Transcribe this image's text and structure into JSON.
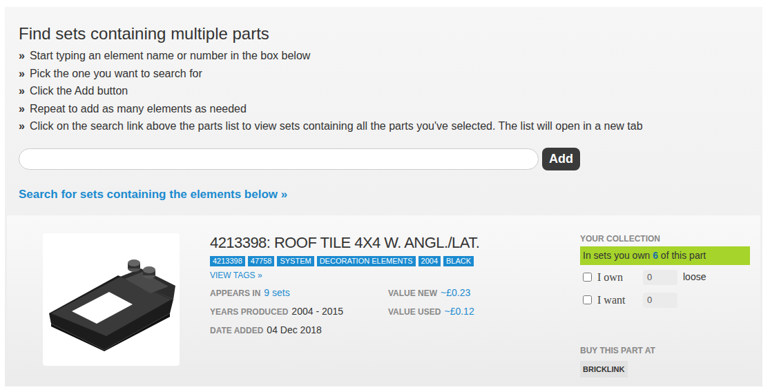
{
  "heading": "Find sets containing multiple parts",
  "instructions": [
    {
      "bullet": "»",
      "text": "Start typing an element name or number in the box below"
    },
    {
      "bullet": "»",
      "text": "Pick the one you want to search for"
    },
    {
      "bullet": "»",
      "text": "Click the Add button"
    },
    {
      "bullet": "»",
      "text": "Repeat to add as many elements as needed"
    },
    {
      "bullet": "»",
      "text": "Click on the search link above the parts list to view sets containing all the parts you've selected. The list will open in a new tab"
    }
  ],
  "search": {
    "value": "",
    "button": "Add"
  },
  "search_link": "Search for sets containing the elements below »",
  "parts": [
    {
      "title": "4213398: ROOF TILE 4X4 W. ANGL./LAT.",
      "tags": [
        "4213398",
        "47758",
        "SYSTEM",
        "DECORATION ELEMENTS",
        "2004",
        "BLACK"
      ],
      "view_tags": "VIEW TAGS »",
      "stats": [
        {
          "label": "APPEARS IN",
          "value": "9 sets",
          "kind": "link"
        },
        {
          "label": "VALUE NEW",
          "value": "~£0.23",
          "kind": "link"
        },
        {
          "label": "YEARS PRODUCED",
          "value": "2004 - 2015",
          "kind": "text"
        },
        {
          "label": "VALUE USED",
          "value": "~£0.12",
          "kind": "link"
        },
        {
          "label": "DATE ADDED",
          "value": "04 Dec 2018",
          "kind": "text"
        }
      ],
      "collection": {
        "label": "YOUR COLLECTION",
        "owned": {
          "prefix": "In sets you own ",
          "count": "6",
          "suffix": " of this part"
        },
        "checks": [
          {
            "label": "I own",
            "checked": false,
            "value": "0",
            "suffix": "loose"
          },
          {
            "label": "I want",
            "checked": false,
            "value": "0",
            "suffix": ""
          }
        ]
      },
      "buy": {
        "label": "BUY THIS PART AT",
        "stores": [
          "BRICKLINK"
        ]
      }
    }
  ]
}
